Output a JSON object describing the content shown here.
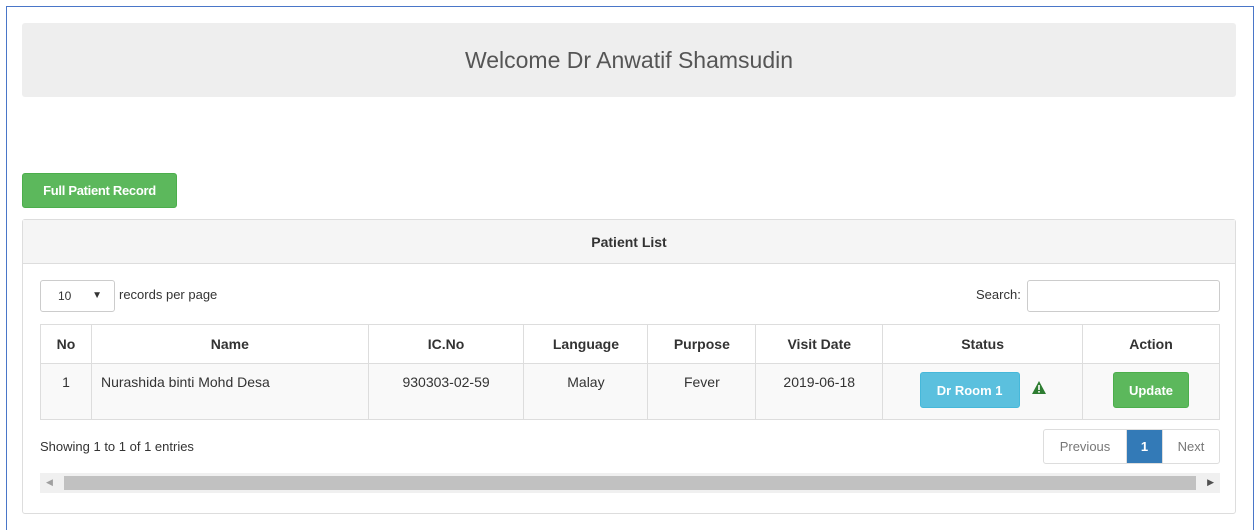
{
  "header": {
    "welcome_text": "Welcome Dr Anwatif Shamsudin"
  },
  "actions": {
    "full_record_label": "Full Patient Record"
  },
  "panel": {
    "title": "Patient List"
  },
  "table_controls": {
    "page_length_value": "10",
    "page_length_label": "records per page",
    "search_label": "Search:",
    "search_value": ""
  },
  "table": {
    "columns": [
      "No",
      "Name",
      "IC.No",
      "Language",
      "Purpose",
      "Visit Date",
      "Status",
      "Action"
    ],
    "rows": [
      {
        "no": "1",
        "name": "Nurashida binti Mohd Desa",
        "ic": "930303-02-59",
        "language": "Malay",
        "purpose": "Fever",
        "visit_date": "2019-06-18",
        "status_label": "Dr Room 1",
        "status_icon": "warning-icon",
        "action_label": "Update"
      }
    ]
  },
  "footer": {
    "info": "Showing 1 to 1 of 1 entries",
    "pager": {
      "previous": "Previous",
      "current": "1",
      "next": "Next"
    }
  },
  "colors": {
    "success": "#5cb85c",
    "info": "#5bc0de",
    "primary": "#337ab7",
    "warning_icon": "#2e7d32"
  }
}
